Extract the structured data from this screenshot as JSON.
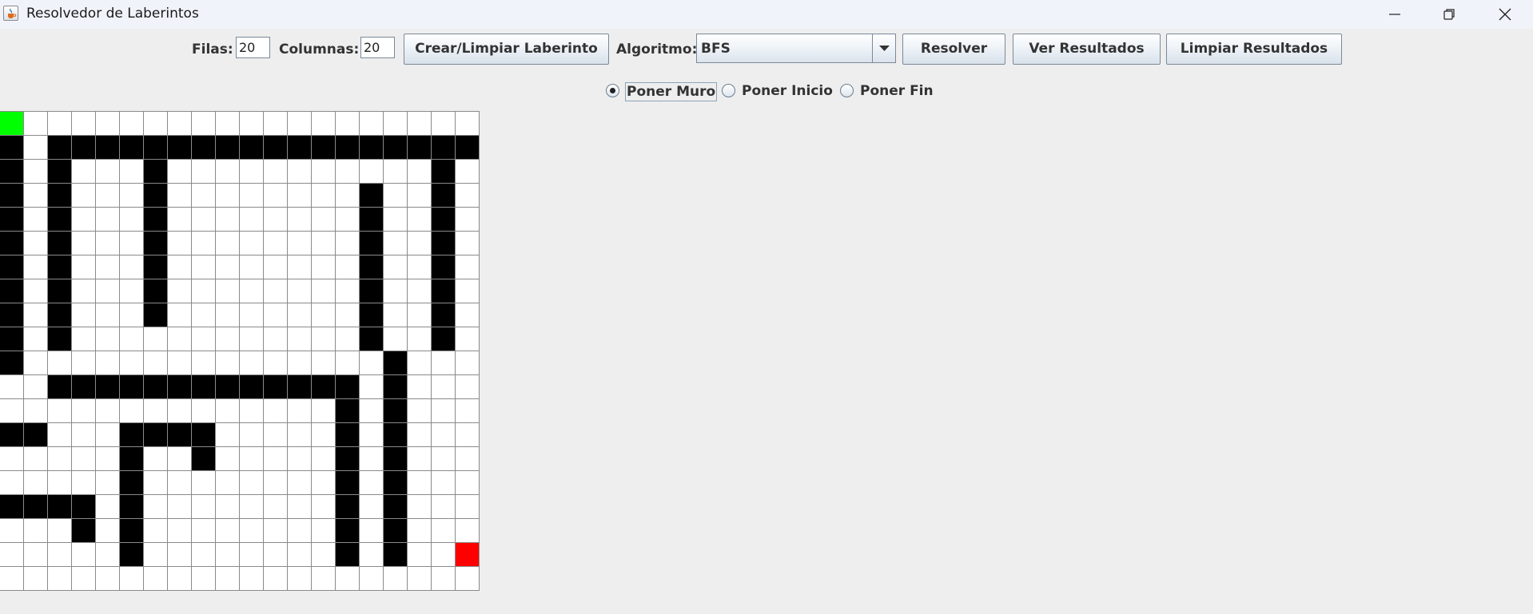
{
  "window": {
    "title": "Resolvedor de Laberintos",
    "icon": "java-cup-icon",
    "controls": [
      "minimize-icon",
      "restore-icon",
      "close-icon"
    ]
  },
  "toolbar": {
    "rows_label": "Filas:",
    "rows_value": "20",
    "cols_label": "Columnas:",
    "cols_value": "20",
    "create_button": "Crear/Limpiar Laberinto",
    "algorithm_label": "Algoritmo:",
    "algorithm_selected": "BFS",
    "solve_button": "Resolver",
    "results_button": "Ver Resultados",
    "clear_results_button": "Limpiar Resultados"
  },
  "modes": {
    "selected": "wall",
    "items": [
      {
        "id": "wall",
        "label": "Poner Muro",
        "checked": true
      },
      {
        "id": "start",
        "label": "Poner Inicio",
        "checked": false
      },
      {
        "id": "end",
        "label": "Poner Fin",
        "checked": false
      }
    ]
  },
  "maze": {
    "rows": 20,
    "cols": 20,
    "legend": {
      "W": "wall",
      "S": "start",
      "E": "end",
      ".": "empty"
    },
    "colors": {
      "wall": "#000000",
      "start": "#00ff00",
      "end": "#ff0000",
      "empty": "#ffffff",
      "gridline": "#8a8a8a"
    },
    "grid": [
      "S...................",
      "W.WWWWWWWWWWWWWWWWWW",
      "W.W...W...........W.",
      "W.W...W........W..W.",
      "W.W...W........W..W.",
      "W.W...W........W..W.",
      "W.W...W........W..W.",
      "W.W...W........W..W.",
      "W.W...W........W..W.",
      "W.W............W..W.",
      "W...............W...",
      "..WWWWWWWWWWWWW.W...",
      "..............W.W...",
      "WW...WWWW.....W.W...",
      ".....W..W.....W.W...",
      ".....W........W.W...",
      "WWWW.W........W.W...",
      "...W.W........W.W...",
      ".....W........W.W..E",
      "...................."
    ]
  }
}
